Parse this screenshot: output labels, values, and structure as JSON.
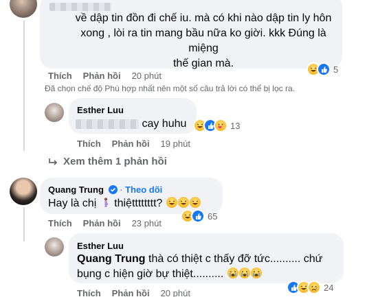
{
  "comment1": {
    "text_lines": [
      "về dập tin đồn đi chế iu. mà có khi nào dập tin ly hôn",
      "xong , lòi ra tin mang bầu nữa ko giời. kkk Đúng là miệng",
      "thế gian mà."
    ],
    "like": "Thích",
    "reply": "Phản hồi",
    "time": "20 phút",
    "reaction_count": "5",
    "reactions": [
      "haha-icon",
      "like-icon"
    ]
  },
  "filter_note": "Đã chọn chế độ Phù hợp nhất nên một số câu trả lời có thể bị lọc ra.",
  "reply1": {
    "author": "Esther Luu",
    "text": "cay huhu",
    "like": "Thích",
    "reply": "Phản hồi",
    "time": "19 phút",
    "reaction_count": "13",
    "reactions": [
      "haha-icon",
      "like-icon",
      "care-icon"
    ]
  },
  "view_more": "Xem thêm 1 phản hồi",
  "comment2": {
    "author": "Quang Trung",
    "separator": "·",
    "follow": "Theo dõi",
    "text_before": "Hay là chị",
    "text_after": "thiệtttttttt?",
    "like": "Thích",
    "reply": "Phản hồi",
    "time": "23 phút",
    "reaction_count": "65",
    "reactions": [
      "haha-icon",
      "like-icon"
    ]
  },
  "reply2": {
    "author": "Esther Luu",
    "mention": "Quang Trung",
    "text_line1": "thà có thiệt c thấy đỡ tức.......... chứ",
    "text_line2": "bụng c hiện giờ bự thiệt..........",
    "like": "Thích",
    "reply": "Phản hồi",
    "time": "20 phút",
    "reaction_count": "24",
    "reactions": [
      "like-icon",
      "haha-icon",
      "sad-icon"
    ]
  },
  "colors": {
    "bubble": "#f0f2f5",
    "secondary_text": "#65676b",
    "facebook_blue": "#1877f2",
    "emoji_yellow": "#f7b928"
  }
}
